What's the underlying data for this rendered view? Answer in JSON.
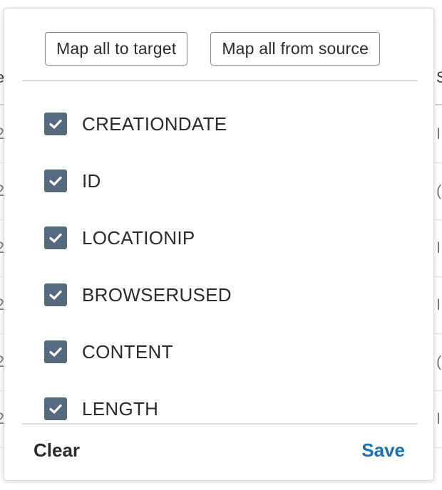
{
  "colors": {
    "checkbox_fill": "#556a7f",
    "save_accent": "#1a6fb5",
    "text": "#2b2b2b"
  },
  "background": {
    "left_header_fragment": "e",
    "right_header_fragment": "S",
    "left_cell_fragments": [
      "2",
      "2",
      "2",
      "2",
      "2",
      "2"
    ],
    "right_cell_fragments": [
      "I",
      "(",
      "I",
      "I",
      "(",
      "I"
    ]
  },
  "popover": {
    "map_all_to_target_label": "Map all to target",
    "map_all_from_source_label": "Map all from source",
    "fields": [
      {
        "label": "CREATIONDATE",
        "checked": true
      },
      {
        "label": "ID",
        "checked": true
      },
      {
        "label": "LOCATIONIP",
        "checked": true
      },
      {
        "label": "BROWSERUSED",
        "checked": true
      },
      {
        "label": "CONTENT",
        "checked": true
      },
      {
        "label": "LENGTH",
        "checked": true
      }
    ],
    "clear_label": "Clear",
    "save_label": "Save"
  }
}
